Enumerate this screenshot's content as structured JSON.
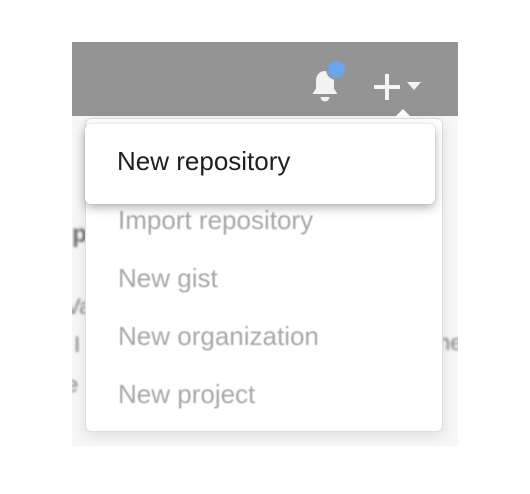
{
  "background_fragments": {
    "heading": "p",
    "line1": "Va",
    "line2": "I",
    "line3": "e",
    "right": "ne"
  },
  "header": {
    "bell_icon": "bell-icon",
    "unread_indicator_color": "#6aa6ee",
    "create_icon": "plus-icon",
    "create_caret_icon": "caret-down-icon",
    "bar_color": "#949494"
  },
  "create_menu": {
    "active_label": "New repository",
    "items": [
      {
        "label": "Import repository"
      },
      {
        "label": "New gist"
      },
      {
        "label": "New organization"
      },
      {
        "label": "New project"
      }
    ]
  }
}
